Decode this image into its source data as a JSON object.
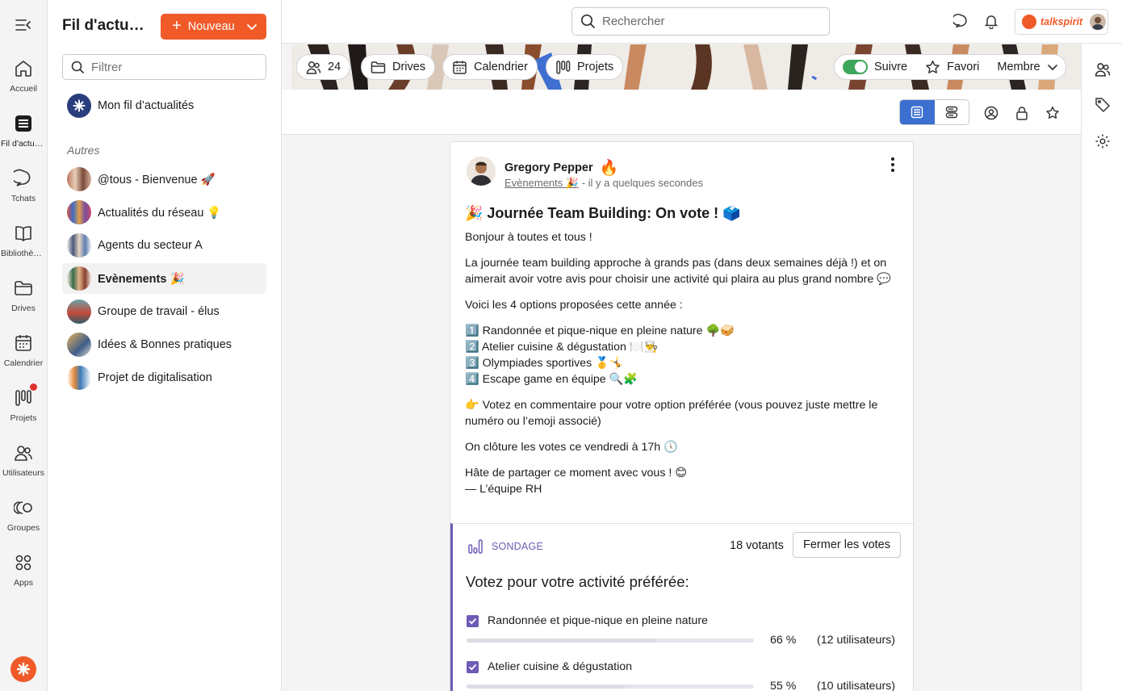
{
  "rail": {
    "items": [
      {
        "label": "Accueil",
        "icon": "home-icon"
      },
      {
        "label": "Fil d'actualités",
        "icon": "feed-icon"
      },
      {
        "label": "Tchats",
        "icon": "chat-icon"
      },
      {
        "label": "Bibliothèque",
        "icon": "book-icon"
      },
      {
        "label": "Drives",
        "icon": "folder-icon"
      },
      {
        "label": "Calendrier",
        "icon": "calendar-icon"
      },
      {
        "label": "Projets",
        "icon": "projects-icon"
      },
      {
        "label": "Utilisateurs",
        "icon": "users-icon"
      },
      {
        "label": "Groupes",
        "icon": "groups-icon"
      },
      {
        "label": "Apps",
        "icon": "apps-icon"
      }
    ]
  },
  "sidebar": {
    "title": "Fil d'actualités",
    "new_button": "Nouveau",
    "filter_placeholder": "Filtrer",
    "my_feed": "Mon fil d’actualités",
    "section_label": "Autres",
    "feeds": [
      {
        "name": "@tous - Bienvenue 🚀"
      },
      {
        "name": "Actualités du réseau 💡"
      },
      {
        "name": "Agents du secteur A"
      },
      {
        "name": "Evènements 🎉"
      },
      {
        "name": "Groupe de travail - élus"
      },
      {
        "name": "Idées & Bonnes pratiques"
      },
      {
        "name": "Projet de digitalisation"
      }
    ]
  },
  "topbar": {
    "search_placeholder": "Rechercher",
    "brand": "talkspirit"
  },
  "group_bar": {
    "members_count": "24",
    "drives": "Drives",
    "calendar": "Calendrier",
    "projects": "Projets",
    "follow": "Suivre",
    "favorite": "Favori",
    "member": "Membre"
  },
  "post": {
    "author": "Gregory Pepper",
    "author_badge": "🔥",
    "feed": "Evènements 🎉",
    "time": "- il y a quelques secondes",
    "title": "🎉 Journée Team Building: On vote ! 🗳️",
    "paragraphs": [
      "Bonjour à toutes et tous !",
      "La journée team building approche à grands pas (dans deux semaines déjà !) et on aimerait avoir votre avis pour choisir une activité qui plaira au plus grand nombre 💬",
      "Voici les 4 options proposées cette année :"
    ],
    "options_list": [
      "1️⃣ Randonnée et pique-nique en pleine nature 🌳🥪",
      "2️⃣ Atelier cuisine & dégustation 🍽️👨‍🍳",
      "3️⃣ Olympiades sportives 🥇🤸",
      "4️⃣ Escape game en équipe 🔍🧩"
    ],
    "cta": "👉 Votez en commentaire pour votre option préférée (vous pouvez juste mettre le numéro ou l’emoji associé)",
    "deadline": "On clôture les votes ce vendredi à 17h 🕔",
    "closing": "Hâte de partager ce moment avec vous ! 😊",
    "signature": "— L’équipe RH"
  },
  "poll": {
    "label": "SONDAGE",
    "voters": "18 votants",
    "close_button": "Fermer les votes",
    "question": "Votez pour votre activité préférée:",
    "options": [
      {
        "text": "Randonnée et pique-nique en pleine nature",
        "percent": 66,
        "pct_label": "66 %",
        "users": "(12 utilisateurs)",
        "checked": true
      },
      {
        "text": "Atelier cuisine & dégustation",
        "percent": 55,
        "pct_label": "55 %",
        "users": "(10 utilisateurs)",
        "checked": true
      }
    ]
  },
  "colors": {
    "accent": "#f05a28",
    "poll": "#6f5bb5",
    "active_view": "#3b6fd0",
    "toggle_on": "#3ea65a"
  }
}
